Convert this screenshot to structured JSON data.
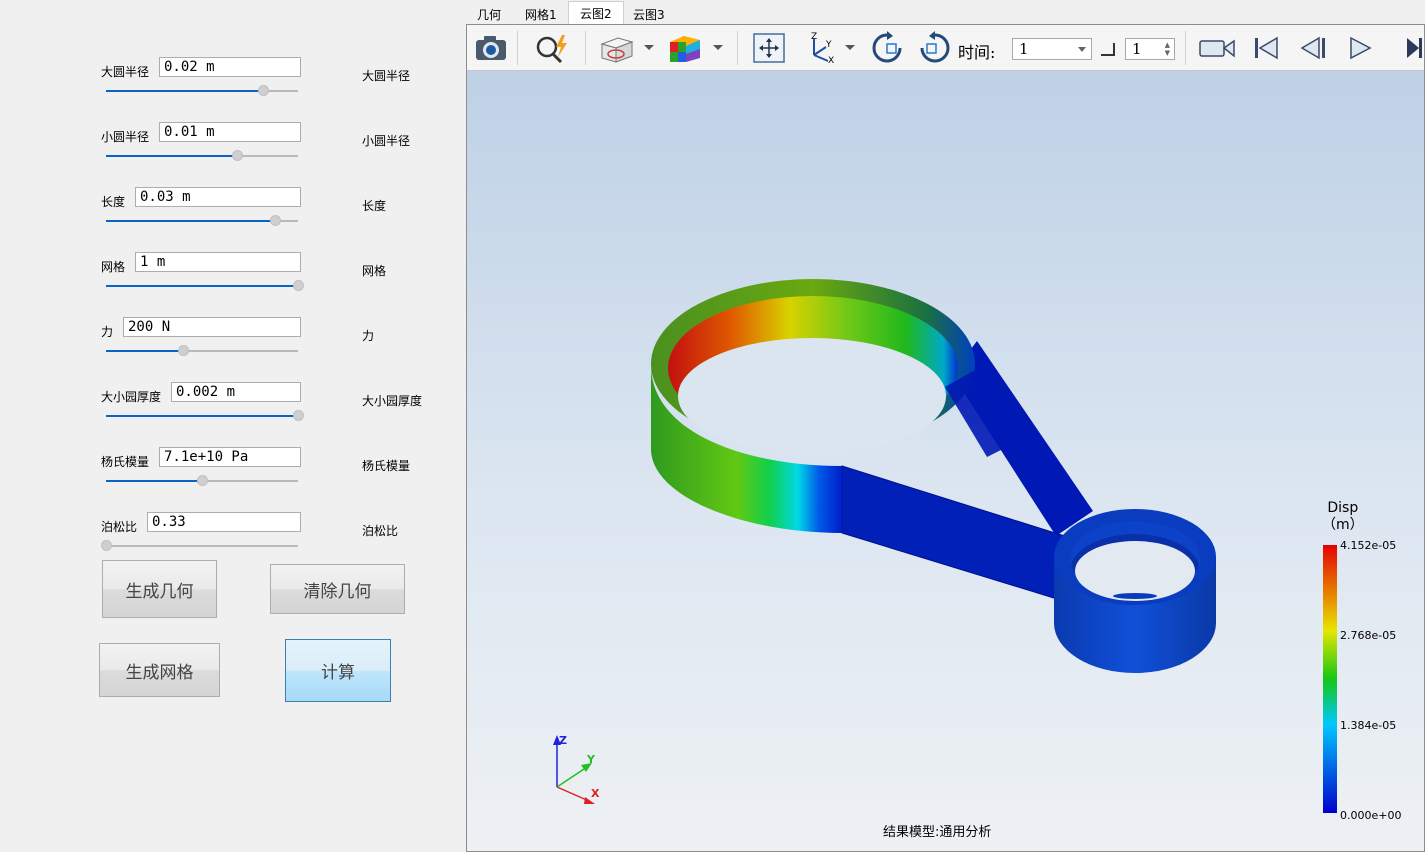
{
  "params": [
    {
      "label": "大圆半径",
      "value": "0.02 m",
      "echo": "大圆半径",
      "slider": 0.82
    },
    {
      "label": "小圆半径",
      "value": "0.01 m",
      "echo": "小圆半径",
      "slider": 0.68
    },
    {
      "label": "长度",
      "value": "0.03 m",
      "echo": "长度",
      "slider": 0.88
    },
    {
      "label": "网格",
      "value": "1 m",
      "echo": "网格",
      "slider": 1.0
    },
    {
      "label": "力",
      "value": "200 N",
      "echo": "力",
      "slider": 0.4
    },
    {
      "label": "大小园厚度",
      "value": "0.002 m",
      "echo": "大小园厚度",
      "slider": 1.0
    },
    {
      "label": "杨氏模量",
      "value": "7.1e+10 Pa",
      "echo": "杨氏模量",
      "slider": 0.5
    },
    {
      "label": "泊松比",
      "value": "0.33",
      "echo": "泊松比",
      "slider": 0.0
    }
  ],
  "buttons": {
    "generate_geometry": "生成几何",
    "clear_geometry": "清除几何",
    "generate_mesh": "生成网格",
    "compute": "计算"
  },
  "tabs": [
    "几何",
    "网格1",
    "云图2",
    "云图3"
  ],
  "active_tab": 2,
  "toolbar": {
    "time_label": "时间:",
    "time_value": "1",
    "step_value": "1"
  },
  "legend": {
    "title_line1": "Disp",
    "title_line2": "（m）",
    "max": "4.152e-05",
    "upper": "2.768e-05",
    "lower": "1.384e-05",
    "min": "0.000e+00",
    "colors": [
      "#0000cc",
      "#00c8ff",
      "#14c814",
      "#e6e600",
      "#e60000"
    ]
  },
  "triad": {
    "x": "X",
    "y": "Y",
    "z": "Z"
  },
  "status": "结果模型:通用分析"
}
